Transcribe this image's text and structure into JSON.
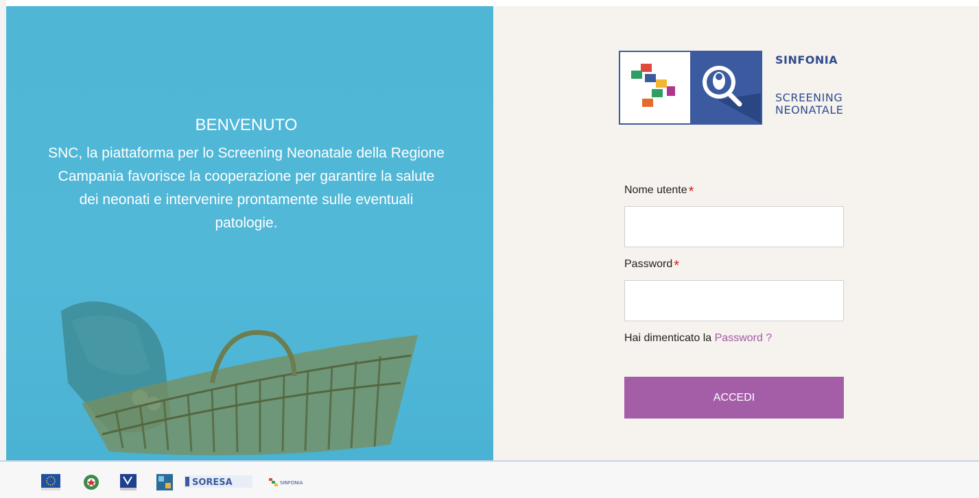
{
  "welcome": {
    "title": "BENVENUTO",
    "text": "SNC, la piattaforma per lo Screening Neonatale della Regione Campania favorisce la cooperazione per garantire la salute dei neonati e intervenire prontamente sulle eventuali patologie."
  },
  "logo": {
    "line1": "SINFONIA",
    "line2": "SCREENING",
    "line3": "NEONATALE"
  },
  "form": {
    "username_label": "Nome utente",
    "username_required": "*",
    "password_label": "Password",
    "password_required": "*",
    "forgot_prefix": "Hai dimenticato la",
    "forgot_link": "Password ?",
    "submit": "ACCEDI"
  },
  "footer": {
    "logos": [
      "eu-flag-icon",
      "italy-emblem-icon",
      "campania-emblem-icon",
      "program-logo-icon",
      "soresa-logo",
      "sinfonia-small-logo"
    ],
    "soresa_text": "SORESA",
    "sinfonia_text": "SINFONIA"
  },
  "colors": {
    "left_panel": "#52b8d8",
    "right_panel": "#f6f2ed",
    "accent": "#a45ea8",
    "brand_blue": "#3b5a9f",
    "required": "#d61f1f"
  }
}
